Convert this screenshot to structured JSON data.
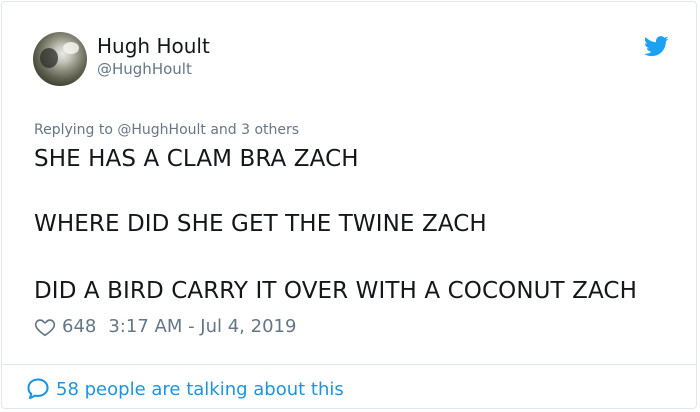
{
  "author": {
    "display_name": "Hugh Hoult",
    "handle": "@HughHoult"
  },
  "icons": {
    "avatar": "avatar-photo",
    "platform": "twitter-bird-icon",
    "like": "heart-outline-icon",
    "conversation": "speech-bubble-icon"
  },
  "tweet": {
    "reply_context": "Replying to @HughHoult and 3 others",
    "lines": [
      "SHE HAS A CLAM BRA ZACH",
      "WHERE DID SHE GET THE TWINE ZACH",
      "DID A BIRD CARRY IT OVER WITH A COCONUT ZACH"
    ],
    "like_count": "648",
    "timestamp": "3:17 AM - Jul 4, 2019"
  },
  "footer": {
    "conversation_label": "58 people are talking about this"
  },
  "colors": {
    "text": "#14171a",
    "secondary": "#657786",
    "accent": "#1b95e0",
    "bird": "#1da1f2",
    "border": "#e1e8ed"
  }
}
